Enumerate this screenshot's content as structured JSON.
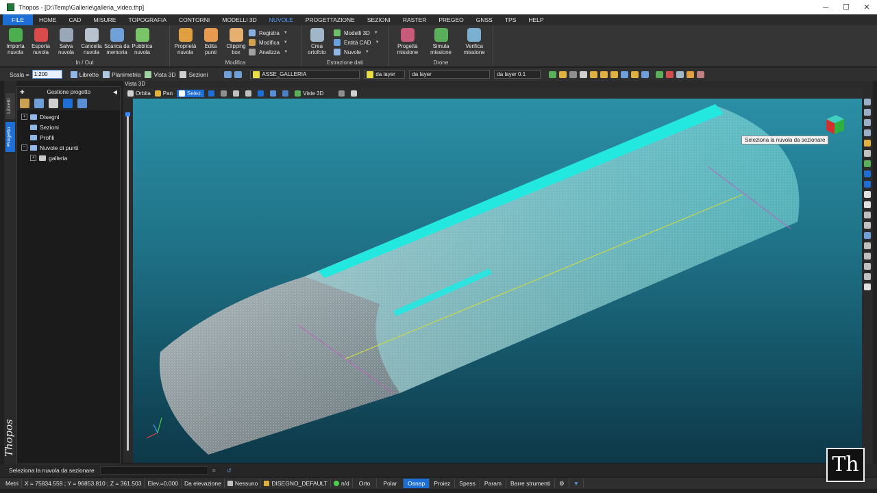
{
  "window": {
    "title": "Thopos - [D:\\Temp\\Gallerie\\galleria_video.thp]"
  },
  "menu": {
    "tabs": [
      "FILE",
      "HOME",
      "CAD",
      "MISURE",
      "TOPOGRAFIA",
      "CONTORNI",
      "MODELLI 3D",
      "NUVOLE",
      "PROGETTAZIONE",
      "SEZIONI",
      "RASTER",
      "PREGEO",
      "GNSS",
      "TPS",
      "HELP"
    ],
    "active": "NUVOLE"
  },
  "ribbon": {
    "inout": {
      "label": "In / Out",
      "buttons": [
        "Importa\nnuvola",
        "Esporta\nnuvola",
        "Salva\nnuvola",
        "Cancella\nnuvola",
        "Scarica da\nmemoria",
        "Pubblica\nnuvola"
      ]
    },
    "modifica": {
      "label": "Modifica",
      "buttons": [
        "Proprietà\nnuvola",
        "Edita\npunti",
        "Clipping\nbox"
      ],
      "list": [
        "Registra",
        "Modifica",
        "Analizza"
      ]
    },
    "estrazione": {
      "label": "Estrazione dati",
      "buttons": [
        "Crea\nortofoto"
      ],
      "list": [
        "Modelli 3D",
        "Entità CAD",
        "Nuvole"
      ]
    },
    "drone": {
      "label": "Drone",
      "buttons": [
        "Progetta\nmissione",
        "Simula\nmissione",
        "Verifica\nmissione"
      ]
    }
  },
  "toolbar": {
    "scala_label": "Scala =",
    "scala_value": "1:200",
    "libretto": "Libretto",
    "planimetria": "Planimetria",
    "vista3d": "Vista 3D",
    "sezioni": "Sezioni",
    "layer": "ASSE_GALLERIA",
    "color": "da layer",
    "linetype": "da layer",
    "lineweight": "da layer 0.1"
  },
  "panel": {
    "title": "Gestione progetto",
    "tabs": [
      "Libretti",
      "Progetto"
    ],
    "tree": [
      "Disegni",
      "Sezioni",
      "Profili",
      "Nuvole di punti",
      "galleria"
    ]
  },
  "viewport": {
    "title": "Vista 3D",
    "tools": [
      "Orbita",
      "Pan",
      "Selez.",
      "Viste 3D"
    ],
    "tooltip": "Seleziona la nuvola da sezionare"
  },
  "status": {
    "prompt": "Seleziona la nuvola da sezionare",
    "units": "Metri",
    "coords": "X = 75834.559 ; Y = 96853.810 ; Z = 361.503",
    "elev": "Elev.=0.000",
    "da_elevazione": "Da elevazione",
    "nessuno": "Nessuno",
    "disegno": "DISEGNO_DEFAULT",
    "nd": "n/d",
    "toggles": [
      "Orto",
      "Polar",
      "Osnap",
      "Proiez",
      "Spess",
      "Param",
      "Barre strumenti"
    ],
    "active_toggle": "Osnap"
  },
  "brand": "Thopos",
  "colors": {
    "accent": "#1d6fd6",
    "cyan": "#23e8e0",
    "axis": "#c8d84a"
  }
}
